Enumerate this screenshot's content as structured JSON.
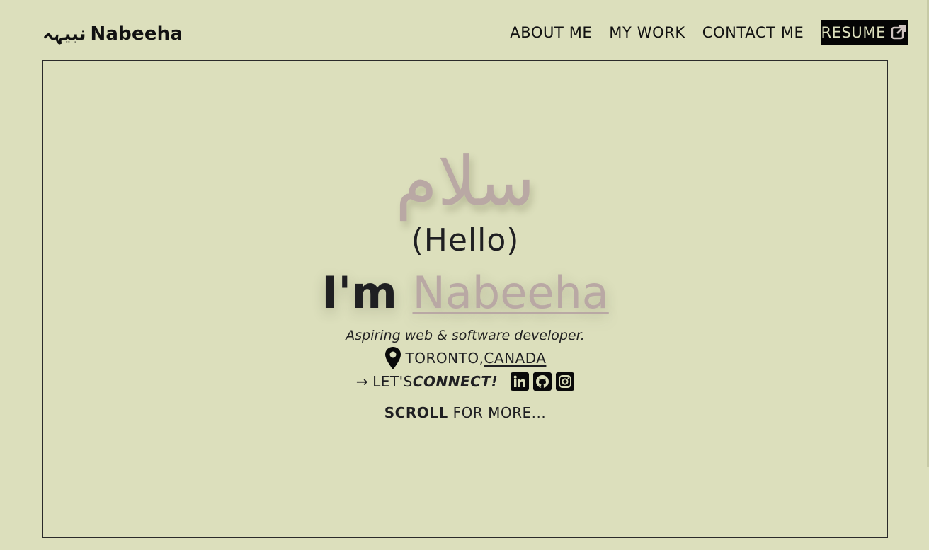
{
  "brand": {
    "logo_mark": "نبیہہ",
    "name": "Nabeeha"
  },
  "nav": {
    "items": [
      {
        "label": "ABOUT ME"
      },
      {
        "label": "MY WORK"
      },
      {
        "label": "CONTACT ME"
      }
    ],
    "resume_label": "RESUME",
    "resume_icon": "external-link-icon"
  },
  "hero": {
    "greeting_native": "سلام",
    "greeting_translation": "(Hello)",
    "intro_prefix": "I'm ",
    "intro_name": "Nabeeha",
    "tagline": "Aspiring web & software developer.",
    "location": {
      "icon": "map-pin-icon",
      "city": "TORONTO,",
      "country": "CANADA"
    },
    "connect": {
      "arrow": "→",
      "prefix": "LET'S ",
      "cta": "CONNECT!",
      "socials": [
        {
          "name": "LinkedIn",
          "icon": "linkedin-icon"
        },
        {
          "name": "GitHub",
          "icon": "github-icon"
        },
        {
          "name": "Instagram",
          "icon": "instagram-icon"
        }
      ]
    },
    "scroll_bold": "SCROLL",
    "scroll_rest": " FOR MORE..."
  },
  "colors": {
    "background": "#dcdfbc",
    "accent": "#b9a8a4",
    "text": "#1f1f22",
    "resume_bg": "#050505"
  }
}
